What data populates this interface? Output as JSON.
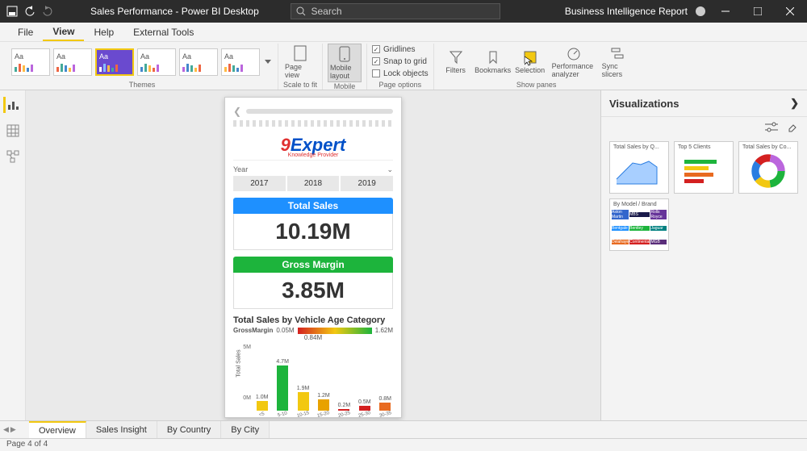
{
  "title": "Sales Performance - Power BI Desktop",
  "search_placeholder": "Search",
  "right_label": "Business Intelligence Report",
  "menu": {
    "file": "File",
    "view": "View",
    "help": "Help",
    "external": "External Tools"
  },
  "ribbon": {
    "themes_label": "Themes",
    "scale_label": "Scale to fit",
    "pageview": "Page view",
    "mobile_label_group": "Mobile",
    "mobile": "Mobile layout",
    "page_options_label": "Page options",
    "gridlines": "Gridlines",
    "snap": "Snap to grid",
    "lock": "Lock objects",
    "show_panes_label": "Show panes",
    "filters": "Filters",
    "bookmarks": "Bookmarks",
    "selection": "Selection",
    "perf": "Performance analyzer",
    "sync": "Sync slicers"
  },
  "phone": {
    "logo_9": "9",
    "logo_ex": "Expert",
    "logo_kp": "Knowledge Provider",
    "year": "Year",
    "y2017": "2017",
    "y2018": "2018",
    "y2019": "2019",
    "total_sales_h": "Total Sales",
    "total_sales_v": "10.19M",
    "gm_h": "Gross Margin",
    "gm_v": "3.85M",
    "chart_title": "Total Sales by Vehicle Age Category",
    "gm_label": "GrossMargin",
    "gm_min": "0.05M",
    "gm_mid": "0.84M",
    "gm_max": "1.62M"
  },
  "chart_data": {
    "type": "bar",
    "title": "Total Sales by Vehicle Age Category",
    "ylabel": "Total Sales",
    "ylim": [
      0,
      5
    ],
    "yticks": [
      "5M",
      "0M"
    ],
    "categories": [
      "<5",
      "5-10",
      "10-15",
      "15-20",
      "20-25",
      "25-30",
      "30-35"
    ],
    "values": [
      1.0,
      4.7,
      1.9,
      1.2,
      0.2,
      0.5,
      0.8
    ],
    "value_labels": [
      "1.0M",
      "4.7M",
      "1.9M",
      "1.2M",
      "0.2M",
      "0.5M",
      "0.8M"
    ],
    "bar_colors": [
      "#f2c811",
      "#1db43c",
      "#f2c811",
      "#e8a200",
      "#d42020",
      "#d42020",
      "#e86a20"
    ],
    "color_scale": {
      "label": "GrossMargin",
      "min": "0.05M",
      "mid": "0.84M",
      "max": "1.62M"
    }
  },
  "viz": {
    "header": "Visualizations",
    "cards": [
      "Total Sales by Q...",
      "Top 5 Clients",
      "Total Sales by Co...",
      "By Model / Brand"
    ]
  },
  "tabs": {
    "overview": "Overview",
    "insight": "Sales Insight",
    "country": "By Country",
    "city": "By City"
  },
  "status": "Page 4 of 4"
}
